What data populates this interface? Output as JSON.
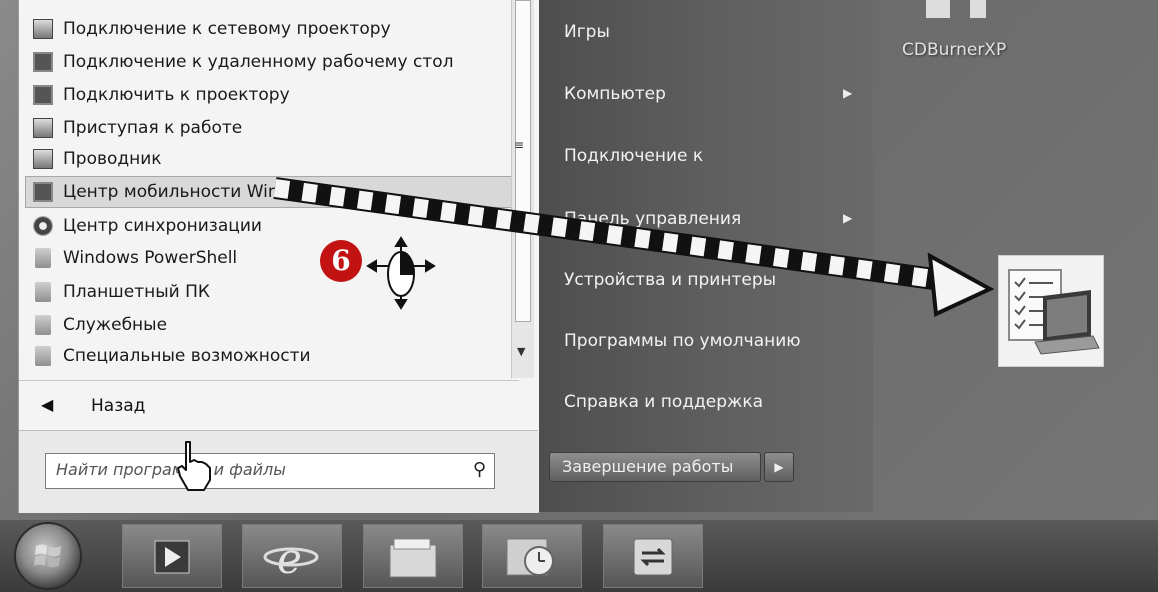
{
  "start_menu": {
    "programs": [
      {
        "label": "Подключение к сетевому проектору",
        "icon": "network-projector-icon",
        "highlighted": false
      },
      {
        "label": "Подключение к удаленному рабочему стол",
        "icon": "remote-desktop-icon",
        "highlighted": false
      },
      {
        "label": "Подключить к проектору",
        "icon": "projector-icon",
        "highlighted": false
      },
      {
        "label": "Приступая к работе",
        "icon": "getting-started-icon",
        "highlighted": false
      },
      {
        "label": "Проводник",
        "icon": "explorer-folder-icon",
        "highlighted": false
      },
      {
        "label": "Центр мобильности Windows",
        "icon": "mobility-center-icon",
        "highlighted": true
      },
      {
        "label": "Центр синхронизации",
        "icon": "sync-center-icon",
        "highlighted": false
      },
      {
        "label": "Windows PowerShell",
        "icon": "folder-icon",
        "highlighted": false
      },
      {
        "label": "Планшетный ПК",
        "icon": "folder-icon",
        "highlighted": false
      },
      {
        "label": "Служебные",
        "icon": "folder-icon",
        "highlighted": false
      },
      {
        "label": "Специальные возможности",
        "icon": "folder-icon",
        "highlighted": false
      }
    ],
    "back_label": "Назад",
    "search_placeholder": "Найти программы и файлы",
    "right_items": [
      {
        "label": "Игры",
        "has_submenu": false
      },
      {
        "label": "Компьютер",
        "has_submenu": true
      },
      {
        "label": "Подключение к",
        "has_submenu": false
      },
      {
        "label": "Панель управления",
        "has_submenu": true
      },
      {
        "label": "Устройства и принтеры",
        "has_submenu": false
      },
      {
        "label": "Программы по умолчанию",
        "has_submenu": false
      },
      {
        "label": "Справка и поддержка",
        "has_submenu": false
      }
    ],
    "shutdown_label": "Завершение работы"
  },
  "desktop": {
    "icon_label": "CDBurnerXP"
  },
  "annotation": {
    "step_number": "6"
  },
  "taskbar": {
    "buttons": [
      "start-orb",
      "media-player-icon",
      "internet-explorer-icon",
      "explorer-icon",
      "outlook-icon",
      "sync-icon"
    ]
  },
  "colors": {
    "step_badge": "#c21212",
    "right_pane": "#5a5a5a",
    "left_pane": "#f4f4f4"
  }
}
